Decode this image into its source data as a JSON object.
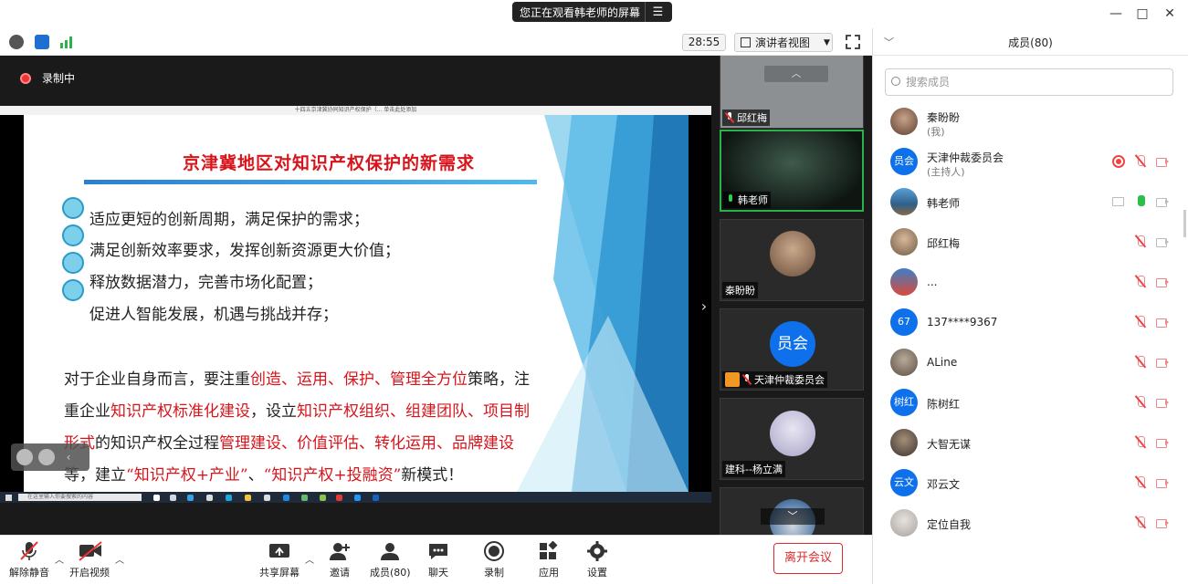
{
  "titlebar": {
    "share_text": "您正在观看韩老师的屏幕",
    "menu_icon": "hamburger-icon",
    "minimize": "—",
    "maximize": "□",
    "close": "✕"
  },
  "toolbar": {
    "timer": "28:55",
    "view_label": "演讲者视图"
  },
  "recording": {
    "label": "录制中"
  },
  "shared_screen": {
    "window_title": "十四五京津冀协同知识产权保护（...    单击此处添加",
    "taskbar_search": "在这里输入你要搜索的内容",
    "slide": {
      "title": "京津冀地区对知识产权保护的新需求",
      "bullets": [
        "适应更短的创新周期，满足保护的需求；",
        "满足创新效率要求，发挥创新资源更大价值；",
        "释放数据潜力，完善市场化配置；",
        "促进人智能发展，机遇与挑战并存；"
      ],
      "para_line1_a": "对于企业自身而言，要注重",
      "para_line1_red": "创造、运用、保护、管理全方位",
      "para_line1_b": "策略，注",
      "para_line2_a": "重企业",
      "para_line2_red1": "知识产权标准化建设",
      "para_line2_b": "，设立",
      "para_line2_red2": "知识产权组织、组建团队、项目制",
      "para_line3_red1": "形式",
      "para_line3_a": "的知识产权全过程",
      "para_line3_red2": "管理建设、价值评估、转化运用、品牌建设",
      "para_line3_b": "",
      "para_line4_a": "等，建立",
      "para_line4_red1": "“知识产权+产业”",
      "para_line4_b": "、",
      "para_line4_red2": "“知识产权+投融资”",
      "para_line4_c": "新模式！"
    }
  },
  "gallery": [
    {
      "name": "邱红梅",
      "mic": "off"
    },
    {
      "name": "韩老师",
      "mic": "on"
    },
    {
      "name": "秦盼盼",
      "mic": "none"
    },
    {
      "name": "天津仲裁委员会",
      "mic": "off",
      "avatar_text": "员会"
    },
    {
      "name": "建科--杨立满",
      "mic": "none"
    },
    {
      "name": "",
      "mic": "none"
    }
  ],
  "controls": {
    "unmute": "解除静音",
    "start_video": "开启视频",
    "share_screen": "共享屏幕",
    "invite": "邀请",
    "participants": "成员(80)",
    "chat": "聊天",
    "record": "录制",
    "apps": "应用",
    "settings": "设置",
    "leave": "离开会议"
  },
  "panel": {
    "title": "成员(80)",
    "search_placeholder": "搜索成员",
    "participants": [
      {
        "name": "秦盼盼",
        "role": "(我)",
        "avatar": "photo",
        "mic": "none",
        "cam": "none"
      },
      {
        "name": "天津仲裁委员会",
        "role": "(主持人)",
        "avatar_text": "员会",
        "mic": "off",
        "cam": "off",
        "recording": true
      },
      {
        "name": "韩老师",
        "role": "",
        "avatar": "photo",
        "mic": "on",
        "cam": "on",
        "sharing": true
      },
      {
        "name": "邱红梅",
        "role": "",
        "avatar": "photo",
        "mic": "off",
        "cam": "on"
      },
      {
        "name": "...",
        "role": "",
        "avatar": "photo",
        "mic": "off",
        "cam": "off"
      },
      {
        "name": "137****9367",
        "role": "",
        "avatar_text": "67",
        "mic": "off",
        "cam": "off"
      },
      {
        "name": "ALine",
        "role": "",
        "avatar": "photo",
        "mic": "off",
        "cam": "off"
      },
      {
        "name": "陈树红",
        "role": "",
        "avatar_text": "树红",
        "mic": "off",
        "cam": "off"
      },
      {
        "name": "大智无谋",
        "role": "",
        "avatar": "photo",
        "mic": "off",
        "cam": "off"
      },
      {
        "name": "邓云文",
        "role": "",
        "avatar_text": "云文",
        "mic": "off",
        "cam": "off"
      },
      {
        "name": "定位自我",
        "role": "",
        "avatar": "photo",
        "mic": "off",
        "cam": "off"
      }
    ]
  },
  "colors": {
    "accent_blue": "#0e71eb",
    "leave_red": "#d92b2b",
    "slide_red": "#d7141b",
    "active_green": "#29b34a"
  }
}
